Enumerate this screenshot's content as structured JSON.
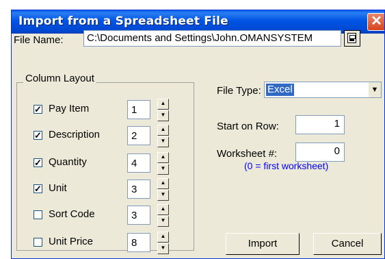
{
  "window": {
    "title": "Import from a Spreadsheet File",
    "close_symbol": "✕"
  },
  "file_name": {
    "label": "File Name:",
    "value": "C:\\Documents and Settings\\John.OMANSYSTEM"
  },
  "column_layout": {
    "title": "Column Layout",
    "rows": [
      {
        "label": "Pay Item",
        "checked": true,
        "value": "1"
      },
      {
        "label": "Description",
        "checked": true,
        "value": "2"
      },
      {
        "label": "Quantity",
        "checked": true,
        "value": "4"
      },
      {
        "label": "Unit",
        "checked": true,
        "value": "3"
      },
      {
        "label": "Sort Code",
        "checked": false,
        "value": "3"
      },
      {
        "label": "Unit Price",
        "checked": false,
        "value": "8"
      }
    ]
  },
  "file_type": {
    "label": "File Type:",
    "value": "Excel",
    "arrow": "▼"
  },
  "start_row": {
    "label": "Start on Row:",
    "value": "1"
  },
  "worksheet": {
    "label": "Worksheet #:",
    "value": "0",
    "hint": "(0 = first worksheet)"
  },
  "buttons": {
    "import": "Import",
    "cancel": "Cancel"
  },
  "spin": {
    "up": "▲",
    "down": "▼"
  },
  "checkmark": "✓"
}
